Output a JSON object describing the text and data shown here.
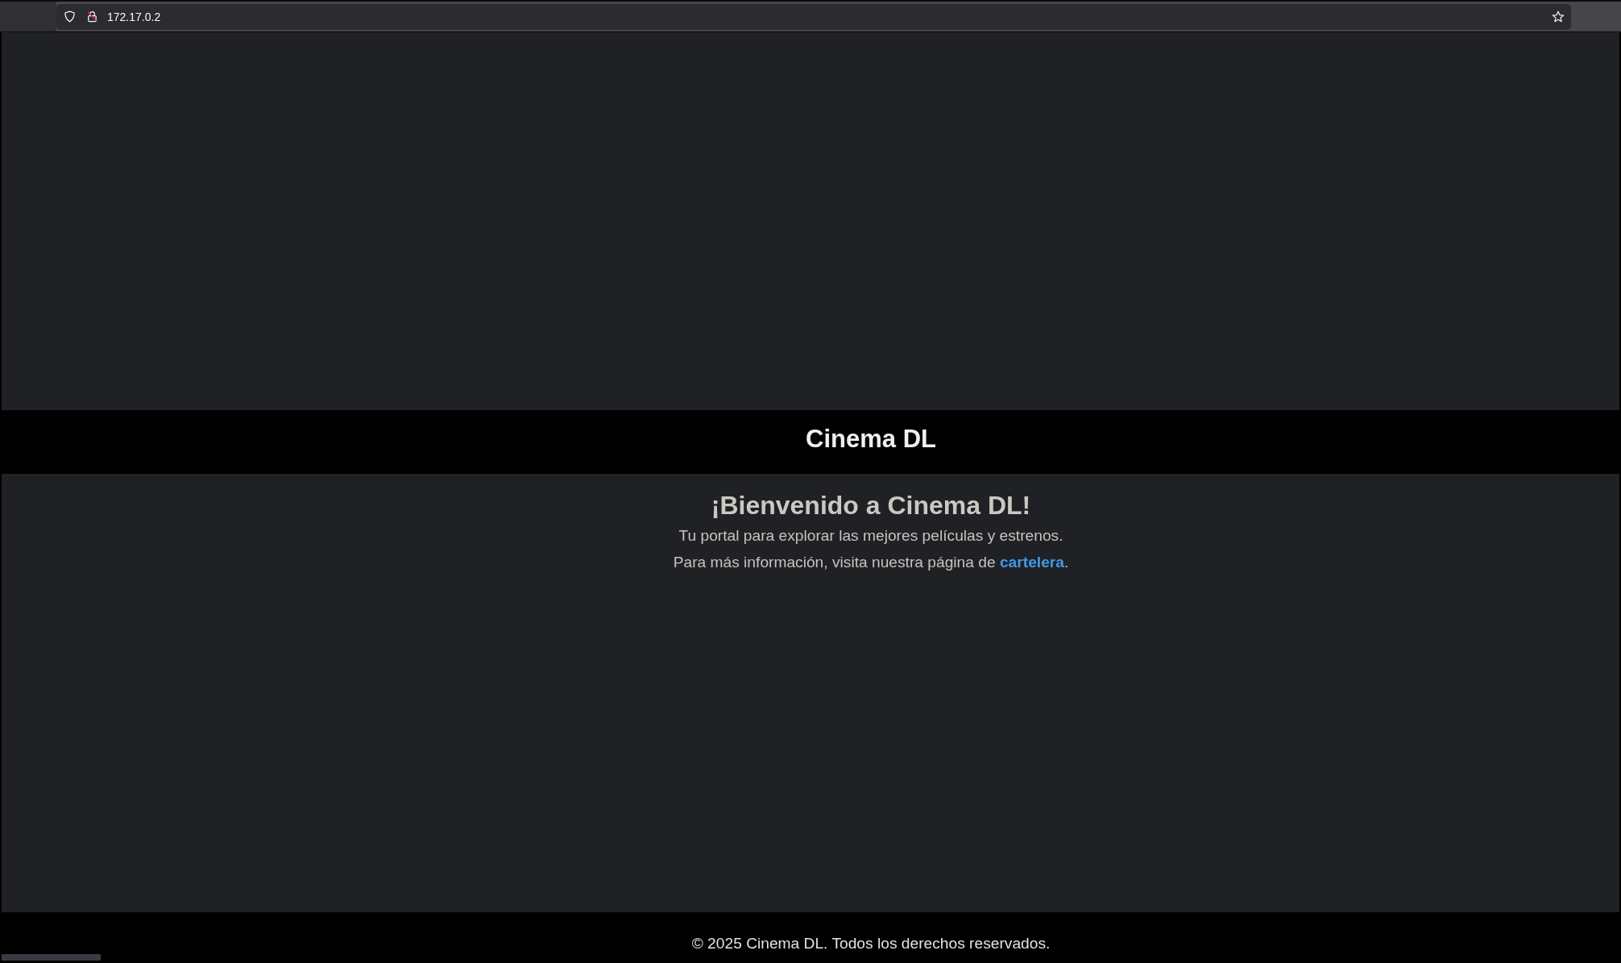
{
  "browser": {
    "url": "172.17.0.2",
    "secure": false
  },
  "header": {
    "title": "Cinema DL"
  },
  "main": {
    "heading": "¡Bienvenido a Cinema DL!",
    "paragraphs": [
      [
        {
          "kind": "text",
          "text": "Tu portal para explorar las mejores películas y estrenos."
        }
      ],
      [
        {
          "kind": "text",
          "text": "Para más información, visita nuestra página de "
        },
        {
          "kind": "link",
          "text": "cartelera"
        },
        {
          "kind": "text",
          "text": "."
        }
      ]
    ]
  },
  "footer": {
    "text": "© 2025 Cinema DL. Todos los derechos reservados."
  }
}
